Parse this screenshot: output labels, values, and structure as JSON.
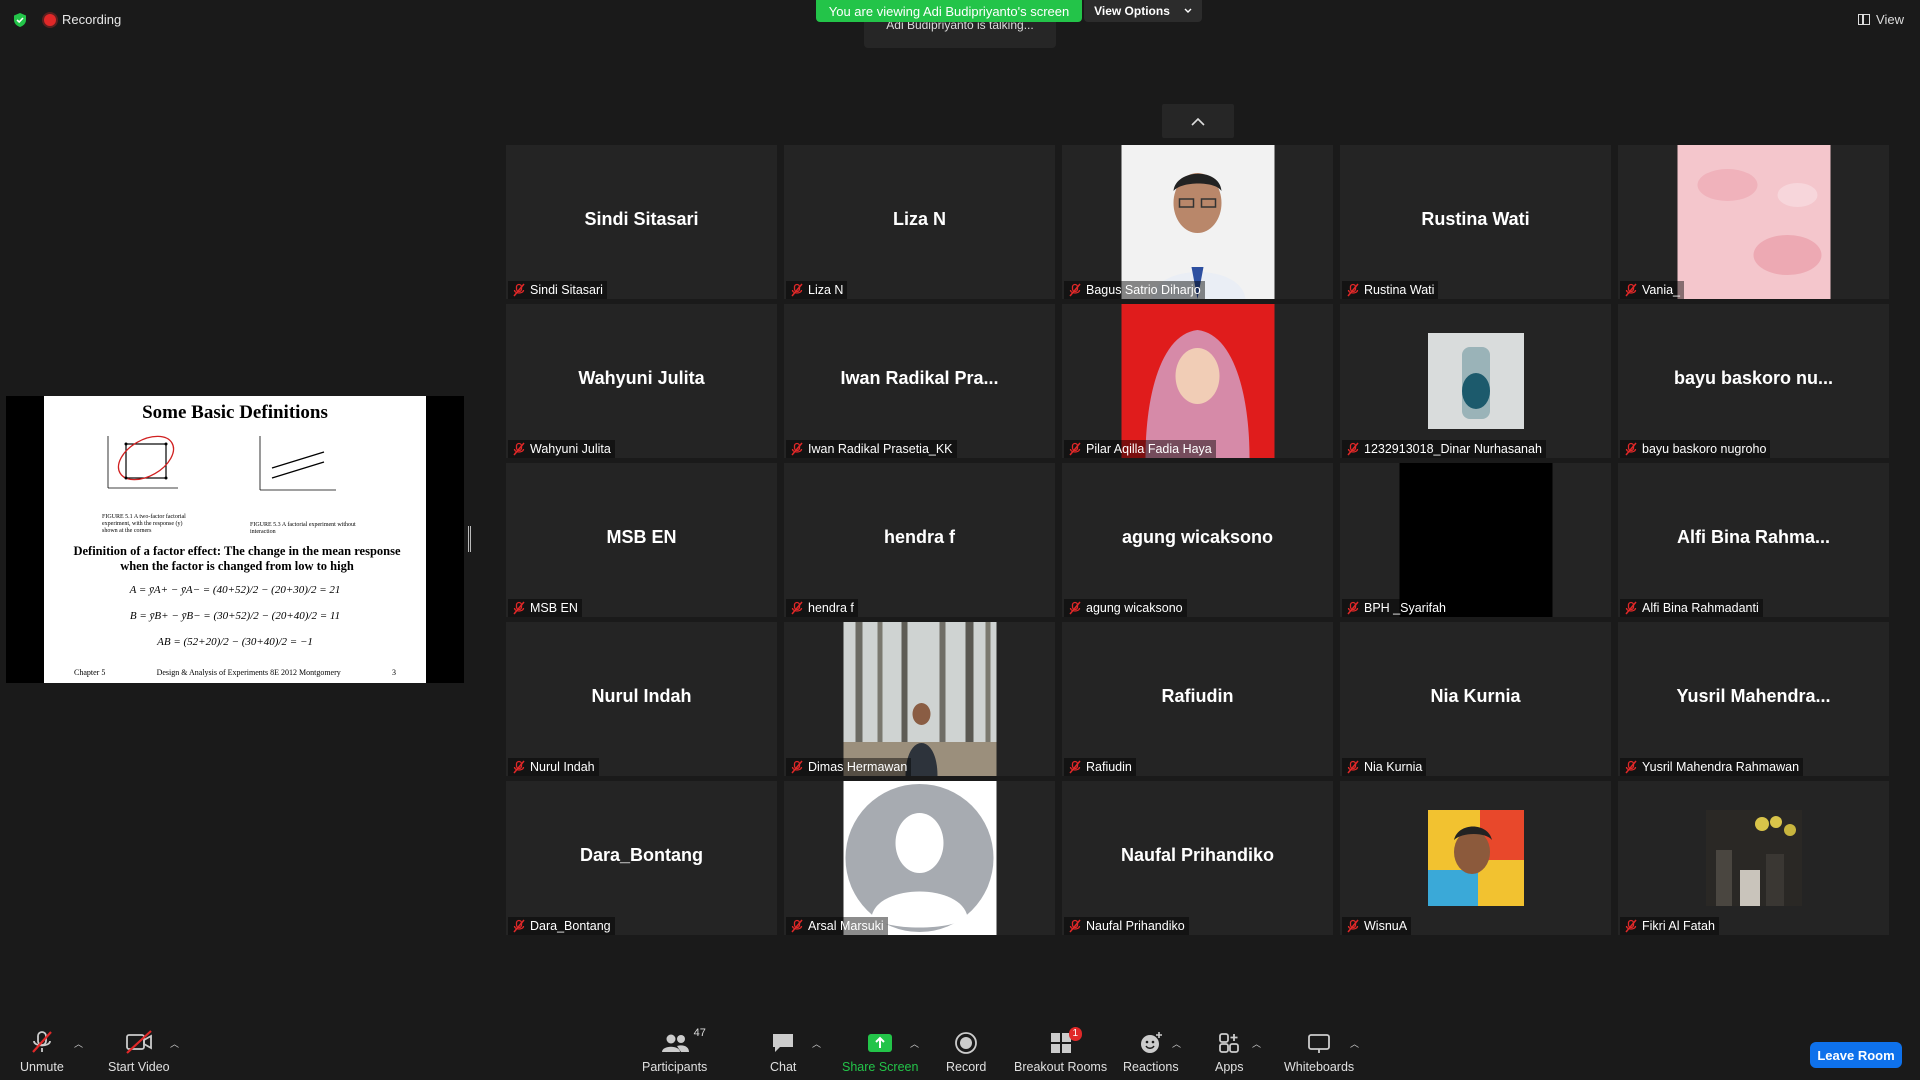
{
  "status": {
    "recording_label": "Recording"
  },
  "banner": {
    "viewing_text": "You are viewing Adi Budipriyanto's screen",
    "view_options_label": "View Options",
    "talking_text": "Adi Budipriyanto is talking..."
  },
  "view_label": "View",
  "slide": {
    "title": "Some Basic Definitions",
    "fig1_caption": "FIGURE 5.1  A two-factor factorial experiment, with the response (y) shown at the corners",
    "fig2_caption": "FIGURE 5.3  A factorial experiment without interaction",
    "definition": "Definition of a factor effect: The change in the mean response when the factor is changed from low to high",
    "eq_a": "A = ȳA+ − ȳA− = (40+52)/2 − (20+30)/2 = 21",
    "eq_b": "B = ȳB+ − ȳB− = (30+52)/2 − (20+40)/2 = 11",
    "eq_ab": "AB = (52+20)/2 − (30+40)/2 = −1",
    "footer_left": "Chapter 5",
    "footer_center": "Design & Analysis of Experiments 8E 2012 Montgomery",
    "footer_right": "3"
  },
  "participants": [
    {
      "center_name": "Sindi Sitasari",
      "label": "Sindi Sitasari",
      "video": "none"
    },
    {
      "center_name": "Liza N",
      "label": "Liza N",
      "video": "none"
    },
    {
      "center_name": "",
      "label": "Bagus Satrio Diharjo",
      "video": "photo-man-white"
    },
    {
      "center_name": "Rustina Wati",
      "label": "Rustina Wati",
      "video": "none"
    },
    {
      "center_name": "",
      "label": "Vania_",
      "video": "pink-texture"
    },
    {
      "center_name": "Wahyuni Julita",
      "label": "Wahyuni Julita",
      "video": "none"
    },
    {
      "center_name": "Iwan Radikal Pra...",
      "label": "Iwan Radikal Prasetia_KK",
      "video": "none"
    },
    {
      "center_name": "",
      "label": "Pilar Aqilla Fadia Haya",
      "video": "photo-hijab-red"
    },
    {
      "center_name": "",
      "label": "1232913018_Dinar Nurhasanah",
      "video": "small-bottle"
    },
    {
      "center_name": "bayu baskoro nu...",
      "label": "bayu baskoro nugroho",
      "video": "none"
    },
    {
      "center_name": "MSB EN",
      "label": "MSB EN",
      "video": "none"
    },
    {
      "center_name": "hendra f",
      "label": "hendra f",
      "video": "none"
    },
    {
      "center_name": "agung wicaksono",
      "label": "agung wicaksono",
      "video": "none"
    },
    {
      "center_name": "",
      "label": "BPH _Syarifah",
      "video": "black"
    },
    {
      "center_name": "Alfi Bina Rahma...",
      "label": "Alfi Bina Rahmadanti",
      "video": "none"
    },
    {
      "center_name": "Nurul Indah",
      "label": "Nurul Indah",
      "video": "none"
    },
    {
      "center_name": "",
      "label": "Dimas Hermawan",
      "video": "photo-forest"
    },
    {
      "center_name": "Rafiudin",
      "label": "Rafiudin",
      "video": "none"
    },
    {
      "center_name": "Nia Kurnia",
      "label": "Nia Kurnia",
      "video": "none"
    },
    {
      "center_name": "Yusril Mahendra...",
      "label": "Yusril Mahendra Rahmawan",
      "video": "none"
    },
    {
      "center_name": "Dara_Bontang",
      "label": "Dara_Bontang",
      "video": "none"
    },
    {
      "center_name": "",
      "label": "Arsal Marsuki",
      "video": "default-avatar"
    },
    {
      "center_name": "Naufal Prihandiko",
      "label": "Naufal Prihandiko",
      "video": "none"
    },
    {
      "center_name": "",
      "label": "WisnuA",
      "video": "small-colorful"
    },
    {
      "center_name": "",
      "label": "Fikri Al Fatah",
      "video": "small-dark-room"
    }
  ],
  "toolbar": {
    "unmute_label": "Unmute",
    "start_video_label": "Start Video",
    "participants_label": "Participants",
    "participants_count": "47",
    "chat_label": "Chat",
    "share_screen_label": "Share Screen",
    "record_label": "Record",
    "breakout_label": "Breakout Rooms",
    "breakout_badge": "1",
    "reactions_label": "Reactions",
    "apps_label": "Apps",
    "whiteboards_label": "Whiteboards",
    "leave_label": "Leave Room"
  },
  "colors": {
    "background": "#1a1a1a",
    "tile": "#242424",
    "banner_green": "#23c449",
    "leave_blue": "#0e71eb",
    "mute_red": "#e02828"
  }
}
